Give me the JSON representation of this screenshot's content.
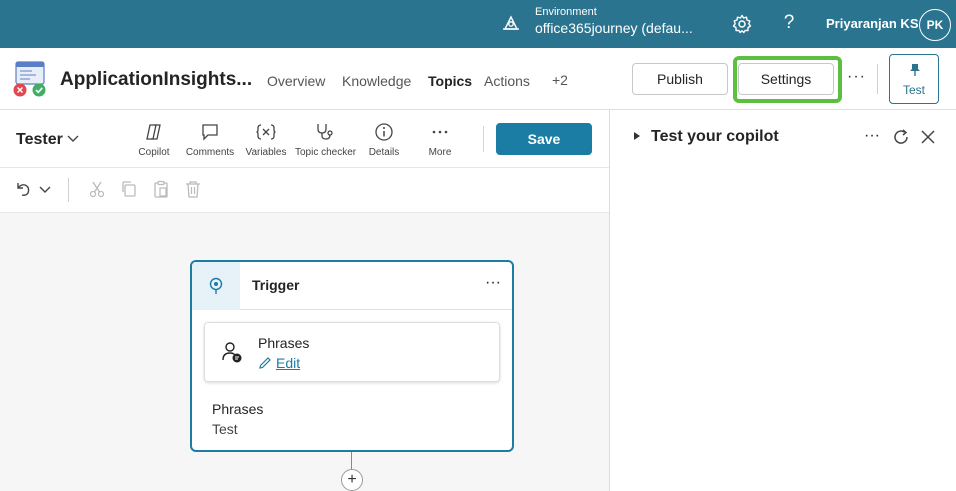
{
  "topbar": {
    "env_label": "Environment",
    "env_value": "office365journey (defau...",
    "user_name": "Priyaranjan KS",
    "avatar_initials": "PK",
    "help_glyph": "?"
  },
  "header": {
    "app_title": "ApplicationInsights...",
    "tabs": [
      "Overview",
      "Knowledge",
      "Topics",
      "Actions",
      "+2"
    ],
    "active_tab": "Topics",
    "publish_label": "Publish",
    "settings_label": "Settings",
    "more_glyph": "···",
    "test_label": "Test"
  },
  "toolbar": {
    "tester_label": "Tester",
    "tools": [
      "Copilot",
      "Comments",
      "Variables",
      "Topic checker",
      "Details",
      "More"
    ],
    "save_label": "Save"
  },
  "node": {
    "title": "Trigger",
    "more_glyph": "···",
    "card_title": "Phrases",
    "card_edit": "Edit",
    "phrases_label": "Phrases",
    "phrases_value": "Test",
    "plus_glyph": "+"
  },
  "right_pane": {
    "title": "Test your copilot",
    "more_glyph": "···"
  },
  "colors": {
    "topbar": "#2a7490",
    "accent": "#1b7da3",
    "highlight": "#5cbf3f"
  }
}
